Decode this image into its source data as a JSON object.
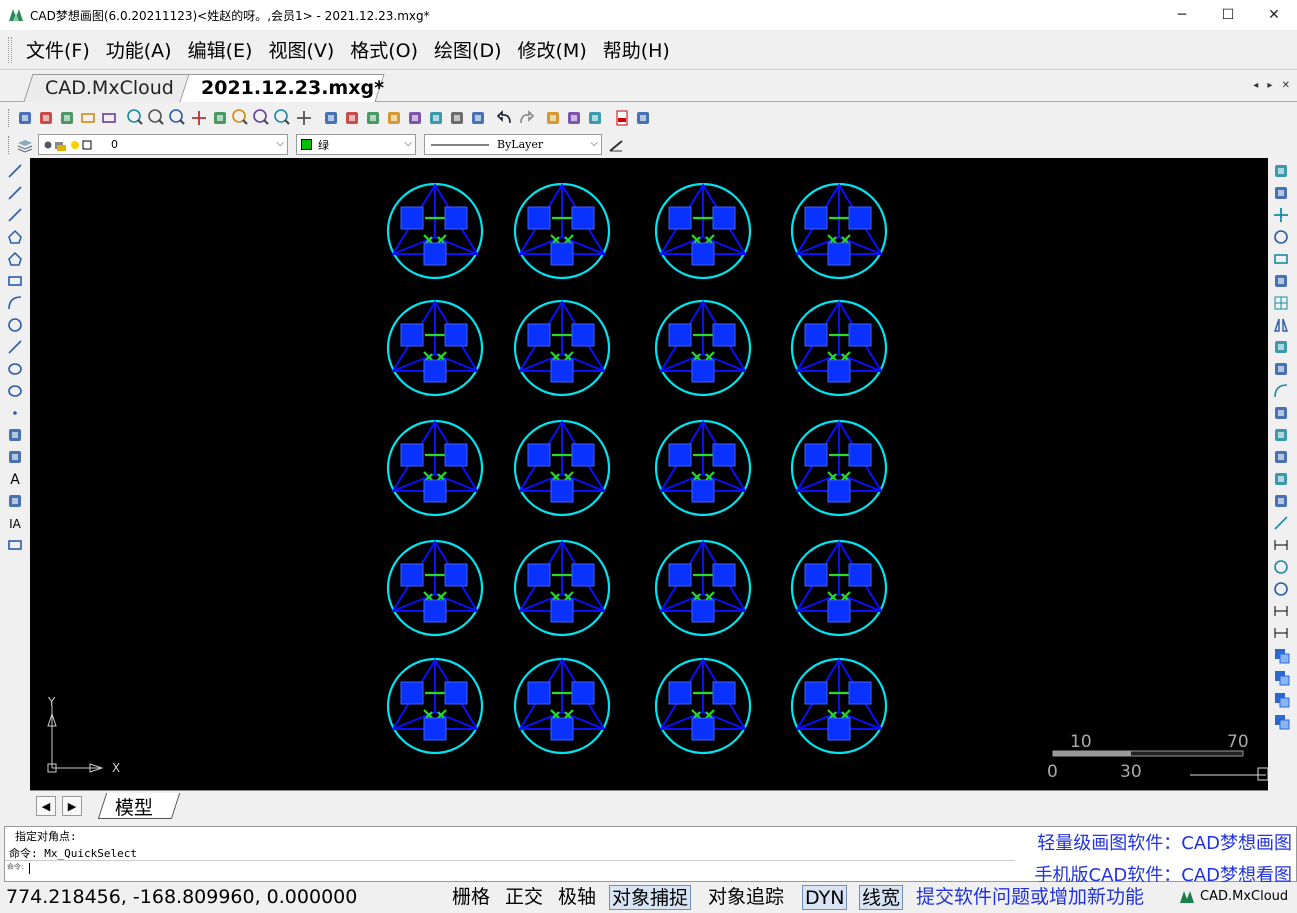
{
  "window": {
    "title": "CAD梦想画图(6.0.20211123)<姓赵的呀。,会员1> - 2021.12.23.mxg*",
    "minimize_glyph": "─",
    "maximize_glyph": "☐",
    "close_glyph": "✕"
  },
  "menu": [
    "文件(F)",
    "功能(A)",
    "编辑(E)",
    "视图(V)",
    "格式(O)",
    "绘图(D)",
    "修改(M)",
    "帮助(H)"
  ],
  "tabs": {
    "inactive": "CAD.MxCloud",
    "active": "2021.12.23.mxg*",
    "nav_glyphs": "◂ ▸ ✕"
  },
  "toolbar1": [
    "new-icon",
    "open-icon",
    "open-folder-icon",
    "save-icon",
    "save-as-icon",
    "zoom-window-icon",
    "zoom-out-icon",
    "zoom-in-icon",
    "pan-icon",
    "measure-angle-icon",
    "zoom-extents-icon",
    "zoom-realtime-icon",
    "zoom-previous-icon",
    "move-view-icon",
    "pencil-icon",
    "palette-icon",
    "layers-stack-icon",
    "brush-icon",
    "image-icon",
    "grid-color-icon",
    "format-painter-icon",
    "properties-icon",
    "undo-icon",
    "redo-icon",
    "print-icon",
    "web-icon",
    "cloud-icon",
    "pdf-icon",
    "export-image-icon"
  ],
  "toolbar2": {
    "layer_value": "0",
    "color_value": "绿",
    "color_hex": "#00c000",
    "linetype_value": "ByLayer"
  },
  "left_tools": [
    "line-icon",
    "construction-line-icon",
    "polyline-icon",
    "polygon-icon",
    "pentagon-icon",
    "rectangle-icon",
    "arc-icon",
    "circle-icon",
    "spline-icon",
    "ellipse-icon",
    "ellipse-arc-icon",
    "point-icon",
    "insert-block-icon",
    "make-block-icon",
    "text-icon",
    "hatch-icon",
    "mtext-icon",
    "table-icon"
  ],
  "right_tools": [
    "erase-icon",
    "copy-icon",
    "move-icon",
    "rotate-icon",
    "scale-icon",
    "offset-icon",
    "array-icon",
    "mirror-icon",
    "stretch-icon",
    "chamfer-icon",
    "fillet-icon",
    "trim-icon",
    "extend-icon",
    "explode-icon",
    "break-icon",
    "join-icon",
    "dim-linear-icon",
    "dim-aligned-icon",
    "dim-radius-icon",
    "dim-diameter-icon",
    "dim-angle-icon",
    "dim-continue-icon",
    "draw-order-front-icon",
    "draw-order-back-icon",
    "draw-order-above-icon",
    "draw-order-below-icon"
  ],
  "canvas": {
    "background": "#000000",
    "circle_color": "#00e5f0",
    "frame_color": "#0a10ff",
    "link_color": "#22dd22",
    "pad_fill": "#0a32ff",
    "pad_stroke": "#4060ff",
    "ucs_x_label": "X",
    "ucs_y_label": "Y",
    "grid_rows": 5,
    "grid_cols": 4,
    "scale_labels": {
      "top_left": "10",
      "top_right": "70",
      "bottom_left": "0",
      "bottom_mid": "30"
    }
  },
  "model": {
    "prev_glyph": "◀",
    "next_glyph": "▶",
    "tab_label": "模型"
  },
  "command": {
    "line1": "指定对角点:",
    "line2": "命令: Mx_QuickSelect",
    "prompt_label": "命令:",
    "ad1": "轻量级画图软件：CAD梦想画图",
    "ad2": "手机版CAD软件：CAD梦想看图"
  },
  "status": {
    "coords": "774.218456,  -168.809960,  0.000000",
    "buttons": [
      {
        "label": "栅格",
        "on": false
      },
      {
        "label": "正交",
        "on": false
      },
      {
        "label": "极轴",
        "on": false
      },
      {
        "label": "对象捕捉",
        "on": true
      },
      {
        "label": "对象追踪",
        "on": false
      },
      {
        "label": "DYN",
        "on": true
      },
      {
        "label": "线宽",
        "on": true
      }
    ],
    "feedback_link": "提交软件问题或增加新功能",
    "brand": "CAD.MxCloud"
  }
}
